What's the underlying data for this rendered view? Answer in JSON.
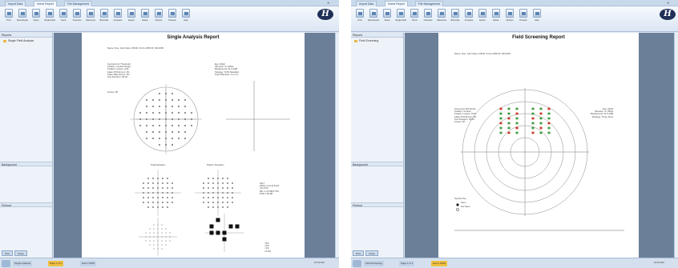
{
  "left": {
    "tabs": [
      "Import Data",
      "Home Report",
      "File Management"
    ],
    "ribbon": [
      "Print",
      "Save Report",
      "Setup",
      "Single Field",
      "Trend",
      "Overview",
      "Glaucoma",
      "Binocular",
      "Compare",
      "Export",
      "Delete",
      "Options",
      "Preview",
      "Help"
    ],
    "logo": "H",
    "panel": {
      "header": "Reports",
      "item": "Single Field Analysis",
      "section_1": "Background",
      "section_2": "Printout",
      "btn_print": "Print",
      "btn_close": "Close"
    },
    "report": {
      "title": "Single Analysis Report",
      "patient_line": "Name: Doe, John   Date of Birth: 01-01-1950   ID: 0012345",
      "left_info": [
        "Central 24-2 Threshold",
        "Fixation: Central Target",
        "Fixation Losses: 0/14",
        "False POS Errors: 2%",
        "False NEG Errors: 0%",
        "Test Duration: 05:34"
      ],
      "right_info": [
        "Eye: Right",
        "Stimulus: III, White",
        "Background: 31.5 ASB",
        "Strategy: SITA Standard",
        "Pupil Diameter: 4.2 mm"
      ],
      "fovea_line": "Fovea: Off",
      "sub_left": "Total Deviation",
      "sub_right": "Pattern Deviation",
      "legend": [
        "GHT",
        "Within normal limits",
        "VFI 97%",
        "MD -1.25 dB P<5%",
        "PSD 1.92 dB"
      ],
      "key": [
        "<5%",
        "<2%",
        "<1%",
        "<0.5%"
      ]
    },
    "status": [
      "Single Analysis",
      "Page 1 of 1",
      "Zoom 100%"
    ],
    "clock": "10:32 AM"
  },
  "right": {
    "tabs": [
      "Import Data",
      "Home Report",
      "File Management"
    ],
    "ribbon": [
      "Print",
      "Save Report",
      "Setup",
      "Single Field",
      "Trend",
      "Overview",
      "Glaucoma",
      "Binocular",
      "Compare",
      "Export",
      "Delete",
      "Options",
      "Preview",
      "Help"
    ],
    "logo": "H",
    "panel": {
      "header": "Reports",
      "item": "Field Screening",
      "section_1": "Background",
      "section_2": "Printout",
      "btn_print": "Print",
      "btn_close": "Close"
    },
    "report": {
      "title": "Field Screening Report",
      "patient_line": "Name: Doe, John   Date of Birth: 01-01-1950   ID: 0012345",
      "left_info": [
        "Screening 120 Points",
        "Fixation: Central",
        "Fixation Losses: 0/10",
        "False POS Errors: 0%",
        "Test Duration: 03:12",
        "Fovea: Off"
      ],
      "right_info": [
        "Eye: Right",
        "Stimulus: III, White",
        "Background: 31.5 ASB",
        "Strategy: Three Zone"
      ],
      "legend": [
        "Symbol Key",
        "Seen",
        "Not Seen"
      ]
    },
    "status": [
      "Field Screening",
      "Page 1 of 1",
      "Zoom 100%"
    ],
    "clock": "10:32 AM"
  }
}
